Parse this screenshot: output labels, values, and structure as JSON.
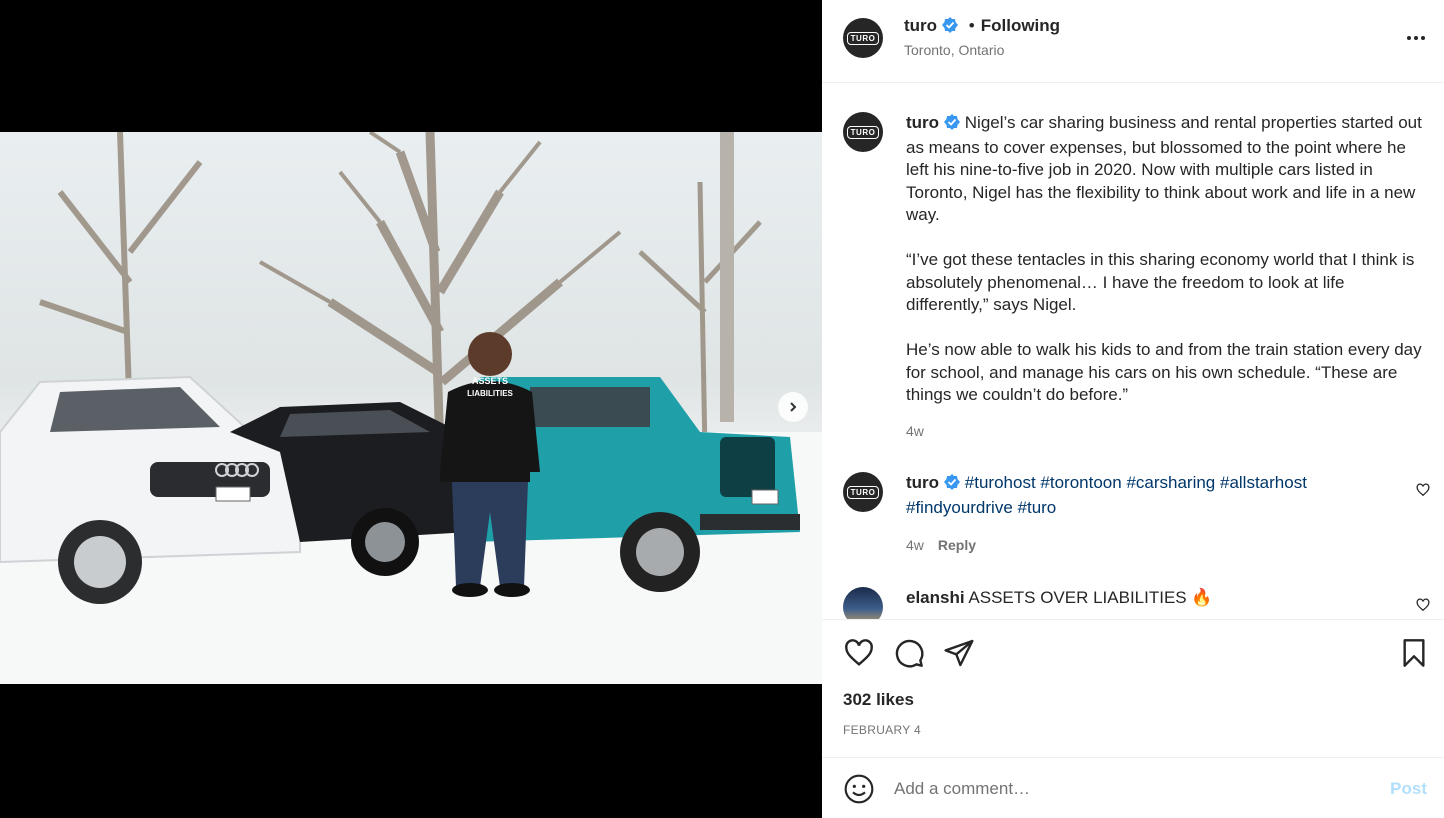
{
  "header": {
    "username": "turo",
    "separator": "•",
    "follow_status": "Following",
    "location": "Toronto, Ontario",
    "avatar_logo": "TURO"
  },
  "caption": {
    "username": "turo",
    "paragraphs": [
      "Nigel’s car sharing business and rental properties started out as means to cover expenses, but blossomed to the point where he left his nine-to-five job in 2020. Now with multiple cars listed in Toronto, Nigel has the flexibility to think about work and life in a new way.",
      "“I’ve got these tentacles in this sharing economy world that I think is absolutely phenomenal… I have the freedom to look at life differently,” says Nigel.",
      "He’s now able to walk his kids to and from the train station every day for school, and manage his cars on his own schedule. “These are things we couldn’t do before.”"
    ],
    "time": "4w"
  },
  "comments": [
    {
      "username": "turo",
      "hashtags": [
        "#turohost",
        "#torontoon",
        "#carsharing",
        "#allstarhost",
        "#findyourdrive",
        "#turo"
      ],
      "time": "4w",
      "reply_label": "Reply"
    },
    {
      "username": "elanshi",
      "text": "ASSETS OVER LIABILITIES 🔥"
    }
  ],
  "actions": {
    "likes": "302 likes",
    "date": "FEBRUARY 4"
  },
  "add_comment": {
    "placeholder": "Add a comment…",
    "post_label": "Post"
  },
  "photo": {
    "shirt_text_top": "ASSETS",
    "shirt_text_bottom": "LIABILITIES"
  },
  "icons": {
    "verified": "verified-badge-icon",
    "more": "more-options-icon",
    "like": "heart-icon",
    "comment": "comment-icon",
    "share": "share-icon",
    "save": "bookmark-icon",
    "emoji": "emoji-icon",
    "next": "chevron-right-icon"
  },
  "colors": {
    "verified": "#3897f0",
    "hashtag": "#00376b",
    "post_disabled": "#b2dffc",
    "jeep": "#1fa0a8"
  }
}
